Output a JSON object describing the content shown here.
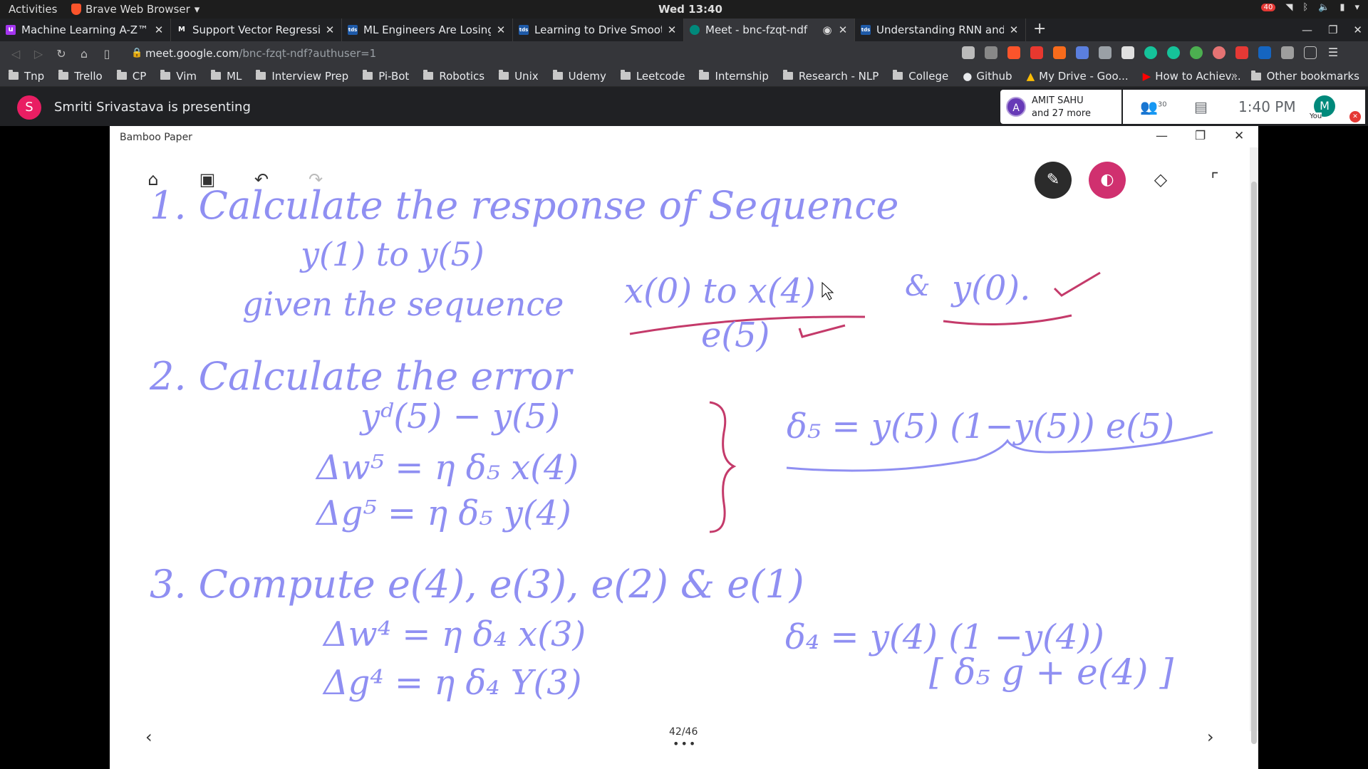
{
  "topbar": {
    "activities": "Activities",
    "browser_name": "Brave Web Browser",
    "clock": "Wed 13:40",
    "notification_count": "40"
  },
  "tabs": [
    {
      "title": "Machine Learning A-Z™: Ha",
      "favicon_color": "#a435f0",
      "favicon_glyph": "u"
    },
    {
      "title": "Support Vector Regression",
      "favicon_color": "#202124",
      "favicon_glyph": "M"
    },
    {
      "title": "ML Engineers Are Losing T",
      "favicon_color": "#1e5aa8",
      "favicon_glyph": "tds"
    },
    {
      "title": "Learning to Drive Smoothly",
      "favicon_color": "#1e5aa8",
      "favicon_glyph": "tds"
    },
    {
      "title": "Meet - bnc-fzqt-ndf",
      "favicon_color": "#00897b",
      "favicon_glyph": "●"
    },
    {
      "title": "Understanding RNN and LS",
      "favicon_color": "#1e5aa8",
      "favicon_glyph": "tds"
    }
  ],
  "address": {
    "domain": "meet.google.com",
    "path": "/bnc-fzqt-ndf?authuser=1"
  },
  "bookmarks": [
    "Tnp",
    "Trello",
    "CP",
    "Vim",
    "ML",
    "Interview Prep",
    "Pi-Bot",
    "Robotics",
    "Unix",
    "Udemy",
    "Leetcode",
    "Internship",
    "Research - NLP",
    "College",
    "Github",
    "My Drive - Goo...",
    "How to Achiev..."
  ],
  "bookmarks_other": "Other bookmarks",
  "meet": {
    "presenter_initial": "S",
    "presenting_text": "Smriti Srivastava is presenting",
    "participant_initial": "A",
    "participant_name": "AMIT SAHU",
    "participant_more": "and 27 more",
    "people_count": "30",
    "time": "1:40 PM",
    "you_initial": "M",
    "you_label": "You"
  },
  "app": {
    "title": "Bamboo Paper",
    "page_indicator": "42/46",
    "pen_dark_color": "#2b2b2b",
    "pen_pink_color": "#d0306f"
  },
  "notes": {
    "l1": "1.   Calculate the response of Sequence",
    "l2": "y(1) to y(5)",
    "l3a": "given the sequence",
    "l3b": "x(0) to x(4)",
    "l3c": "&",
    "l3d": "y(0).",
    "l4": "e(5)",
    "l5": "2.   Calculate the error",
    "l6": "yᵈ(5) − y(5)",
    "l7": "Δw⁵ = η δ₅ x(4)",
    "l8": "Δg⁵ = η δ₅ y(4)",
    "l9": "δ₅ = y(5) (1−y(5)) e(5)",
    "l10": "3.   Compute e(4), e(3), e(2) & e(1)",
    "l11": "Δw⁴ = η δ₄ x(3)",
    "l12": "Δg⁴ = η δ₄ Y(3)",
    "l13": "δ₄ = y(4) (1 −y(4))",
    "l14": "[ δ₅ g + e(4) ]"
  }
}
